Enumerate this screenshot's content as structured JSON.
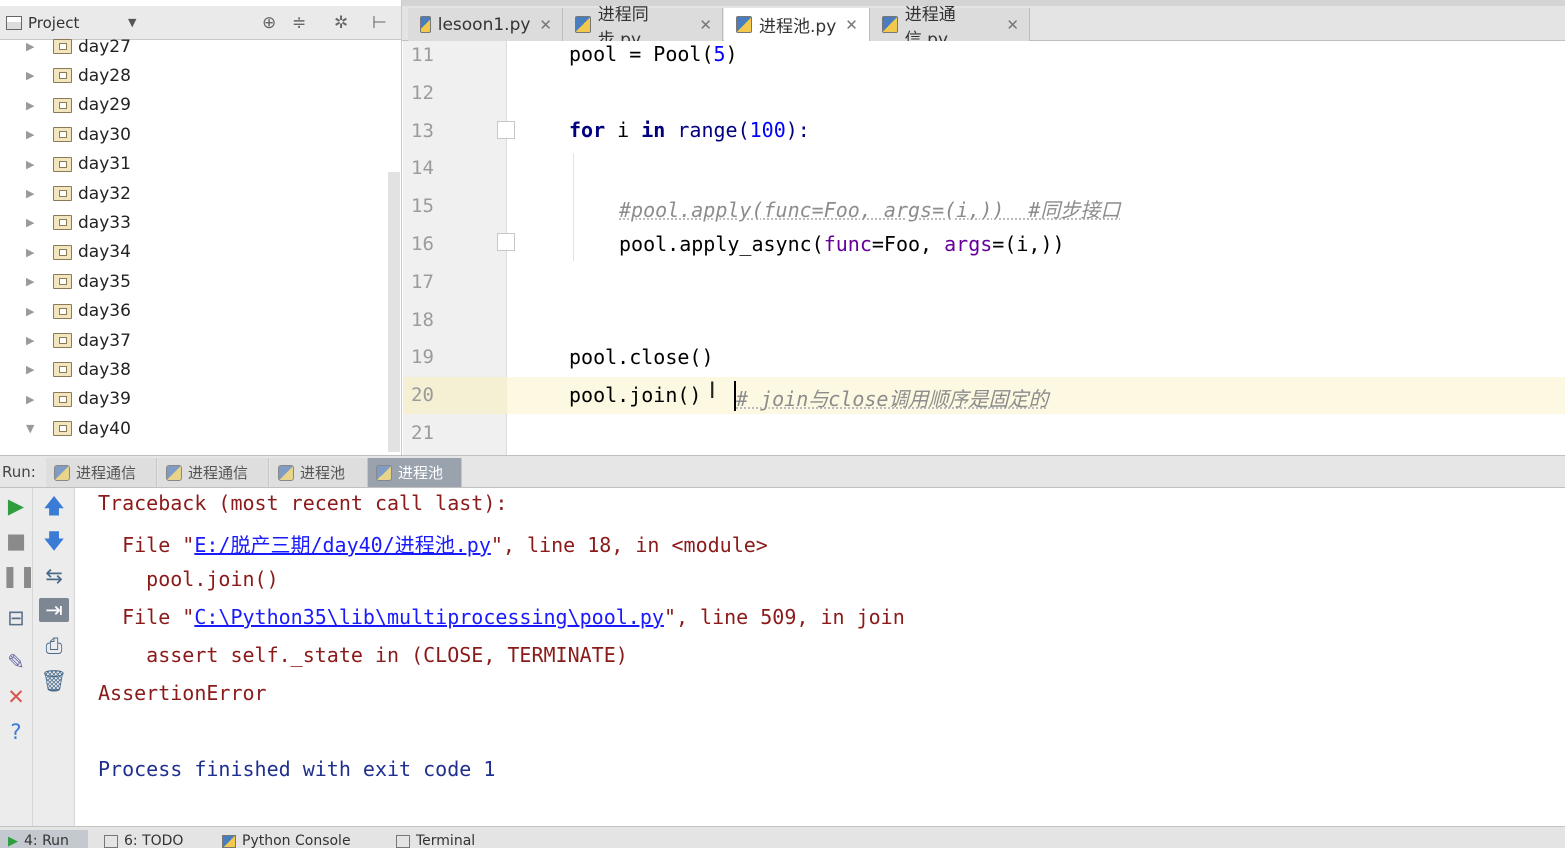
{
  "project": {
    "title": "Project",
    "folders": [
      "day27",
      "day28",
      "day29",
      "day30",
      "day31",
      "day32",
      "day33",
      "day34",
      "day35",
      "day36",
      "day37",
      "day38",
      "day39",
      "day40"
    ]
  },
  "tabs": [
    {
      "label": "lesoon1.py",
      "active": false
    },
    {
      "label": "进程同步.py",
      "active": false
    },
    {
      "label": "进程池.py",
      "active": true
    },
    {
      "label": "进程通信.py",
      "active": false
    }
  ],
  "editor": {
    "line_numbers": [
      "11",
      "12",
      "13",
      "14",
      "15",
      "16",
      "17",
      "18",
      "19",
      "20",
      "21"
    ],
    "code": {
      "l11_a": "pool = Pool(",
      "l11_num": "5",
      "l11_b": ")",
      "l13_for": "for",
      "l13_i": " i ",
      "l13_in": "in",
      "l13_range": " range(",
      "l13_num": "100",
      "l13_end": "):",
      "l15_comment": "#pool.apply(func=Foo, args=(i,))  #同步接口",
      "l16_a": "pool.apply_async(",
      "l16_func": "func",
      "l16_b": "=Foo, ",
      "l16_args": "args",
      "l16_c": "=(i,))",
      "l19": "pool.close()",
      "l20": "pool.join()",
      "l20_comment": "# join与close调用顺序是固定的"
    }
  },
  "run": {
    "label": "Run:",
    "tabs": [
      {
        "label": "进程通信",
        "active": false
      },
      {
        "label": "进程通信",
        "active": false
      },
      {
        "label": "进程池",
        "active": false
      },
      {
        "label": "进程池",
        "active": true
      }
    ]
  },
  "console": {
    "traceback": "Traceback (most recent call last):",
    "file1_pre": "  File \"",
    "file1_link": "E:/脱产三期/day40/进程池.py",
    "file1_post": "\", line 18, in <module>",
    "code1": "    pool.join()",
    "file2_pre": "  File \"",
    "file2_link": "C:\\Python35\\lib\\multiprocessing\\pool.py",
    "file2_post": "\", line 509, in join",
    "code2": "    assert self._state in (CLOSE, TERMINATE)",
    "error": "AssertionError",
    "finished": "Process finished with exit code 1"
  },
  "statusbar": {
    "run": "4: Run",
    "todo": "6: TODO",
    "python_console": "Python Console",
    "terminal": "Terminal"
  },
  "colors": {
    "keyword": "#000080",
    "number": "#0000ff",
    "comment": "#8c8c8c",
    "error_text": "#8b1a1a",
    "link": "#1a1aff",
    "current_line": "#fdf8e1"
  }
}
